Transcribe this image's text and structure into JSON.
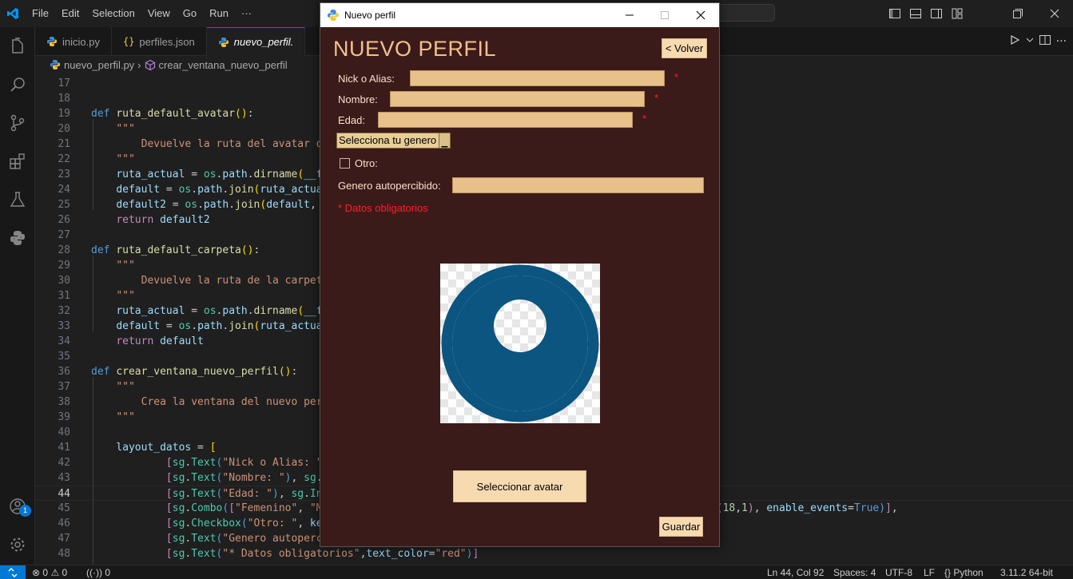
{
  "menu": [
    "File",
    "Edit",
    "Selection",
    "View",
    "Go",
    "Run",
    "···"
  ],
  "tabs": [
    {
      "label": "inicio.py",
      "icon": "python-icon"
    },
    {
      "label": "perfiles.json",
      "icon": "json-icon"
    },
    {
      "label": "nuevo_perfil.",
      "icon": "python-icon"
    }
  ],
  "breadcrumb": {
    "file": "nuevo_perfil.py",
    "symbol": "crear_ventana_nuevo_perfil"
  },
  "code_lines": [
    {
      "n": "17",
      "html": ""
    },
    {
      "n": "18",
      "html": ""
    },
    {
      "n": "19",
      "html": "<span class='kw'>def</span> <span class='fn'>ruta_default_avatar</span><span class='punc'>()</span>:"
    },
    {
      "n": "20",
      "html": "    <span class='str'>\"\"\"</span>"
    },
    {
      "n": "21",
      "html": "<span class='str'>        Devuelve la ruta del avatar d</span>"
    },
    {
      "n": "22",
      "html": "    <span class='str'>\"\"\"</span>"
    },
    {
      "n": "23",
      "html": "    <span class='var'>ruta_actual</span> = <span class='cls'>os</span>.<span class='var'>path</span>.<span class='fn'>dirname</span><span class='punc'>(</span><span class='var'>__f</span>"
    },
    {
      "n": "24",
      "html": "    <span class='var'>default</span> = <span class='cls'>os</span>.<span class='var'>path</span>.<span class='fn'>join</span><span class='punc'>(</span><span class='var'>ruta_actua</span>"
    },
    {
      "n": "25",
      "html": "    <span class='var'>default2</span> = <span class='cls'>os</span>.<span class='var'>path</span>.<span class='fn'>join</span><span class='punc'>(</span><span class='var'>default</span>,"
    },
    {
      "n": "26",
      "html": "    <span class='kw2'>return</span> <span class='var'>default2</span>"
    },
    {
      "n": "27",
      "html": ""
    },
    {
      "n": "28",
      "html": "<span class='kw'>def</span> <span class='fn'>ruta_default_carpeta</span><span class='punc'>()</span>:"
    },
    {
      "n": "29",
      "html": "    <span class='str'>\"\"\"</span>"
    },
    {
      "n": "30",
      "html": "<span class='str'>        Devuelve la ruta de la carpet</span>"
    },
    {
      "n": "31",
      "html": "    <span class='str'>\"\"\"</span>"
    },
    {
      "n": "32",
      "html": "    <span class='var'>ruta_actual</span> = <span class='cls'>os</span>.<span class='var'>path</span>.<span class='fn'>dirname</span><span class='punc'>(</span><span class='var'>__f</span>"
    },
    {
      "n": "33",
      "html": "    <span class='var'>default</span> = <span class='cls'>os</span>.<span class='var'>path</span>.<span class='fn'>join</span><span class='punc'>(</span><span class='var'>ruta_actua</span>"
    },
    {
      "n": "34",
      "html": "    <span class='kw2'>return</span> <span class='var'>default</span>"
    },
    {
      "n": "35",
      "html": ""
    },
    {
      "n": "36",
      "html": "<span class='kw'>def</span> <span class='fn'>crear_ventana_nuevo_perfil</span><span class='punc'>()</span>:"
    },
    {
      "n": "37",
      "html": "    <span class='str'>\"\"\"</span>"
    },
    {
      "n": "38",
      "html": "<span class='str'>        Crea la ventana del nuevo per</span>"
    },
    {
      "n": "39",
      "html": "    <span class='str'>\"\"\"</span>"
    },
    {
      "n": "40",
      "html": ""
    },
    {
      "n": "41",
      "html": "    <span class='var'>layout_datos</span> = <span class='punc'>[</span>"
    },
    {
      "n": "42",
      "html": "            <span class='kw2'>[</span><span class='cls'>sg</span>.<span class='cls'>Text</span><span class='kw'>(</span><span class='str'>\"Nick o Alias: \"</span>"
    },
    {
      "n": "43",
      "html": "            <span class='kw2'>[</span><span class='cls'>sg</span>.<span class='cls'>Text</span><span class='kw'>(</span><span class='str'>\"Nombre: \"</span><span class='kw'>)</span>, <span class='cls'>sg</span>."
    },
    {
      "n": "44",
      "html": "            <span class='kw2'>[</span><span class='cls'>sg</span>.<span class='cls'>Text</span><span class='kw'>(</span><span class='str'>\"Edad: \"</span><span class='kw'>)</span>, <span class='cls'>sg</span>.<span class='cls'>In</span>"
    },
    {
      "n": "45",
      "html": "            <span class='kw2'>[</span><span class='cls'>sg</span>.<span class='cls'>Combo</span><span class='kw'>(</span><span class='kw2'>[</span><span class='str'>\"Femenino\"</span>, <span class='str'>\"M</span>                                           <span class='var'>readonly</span>=<span class='bool'>True</span>, <span class='var'>size</span>=<span class='kw2'>(</span><span class='num'>18</span>,<span class='num'>1</span><span class='kw2'>)</span>, <span class='var'>enable_events</span>=<span class='bool'>True</span><span class='kw'>)</span><span class='kw2'>]</span>,"
    },
    {
      "n": "46",
      "html": "            <span class='kw2'>[</span><span class='cls'>sg</span>.<span class='cls'>Checkbox</span><span class='kw'>(</span><span class='str'>\"Otro: \"</span>, <span class='var'>ke</span>"
    },
    {
      "n": "47",
      "html": "            <span class='kw2'>[</span><span class='cls'>sg</span>.<span class='cls'>Text</span><span class='kw'>(</span><span class='str'>\"Genero autoperc</span>"
    },
    {
      "n": "48",
      "html": "            <span class='kw2'>[</span><span class='cls'>sg</span>.<span class='cls'>Text</span><span class='kw'>(</span><span class='str'>\"* Datos obligatorios\"</span>,<span class='var'>text_color</span>=<span class='str'>\"red\"</span><span class='kw'>)</span><span class='kw2'>]</span>"
    }
  ],
  "current_line": "44",
  "status": {
    "errors": "0",
    "warnings": "0",
    "ports": "0",
    "position": "Ln 44, Col 92",
    "spaces": "Spaces: 4",
    "encoding": "UTF-8",
    "eol": "LF",
    "language": "Python",
    "interpreter": "3.11.2 64-bit"
  },
  "accounts_badge": "1",
  "popup": {
    "title": "Nuevo perfil",
    "heading": "NUEVO PERFIL",
    "back_button": "< Volver",
    "nick_label": "Nick o Alias:",
    "nombre_label": "Nombre:",
    "edad_label": "Edad:",
    "star": "*",
    "combo_value": "Selecciona tu genero",
    "otro_label": "Otro:",
    "genero_label": "Genero autopercibido:",
    "required_note": "* Datos obligatorios",
    "select_avatar_button": "Seleccionar avatar",
    "save_button": "Guardar"
  },
  "colors": {
    "popup_bg": "#3b1a1a",
    "heading": "#f2c18d",
    "input_bg": "#e8c08a",
    "button_bg": "#f7dab0",
    "required": "#ff2020",
    "avatar": "#0b5580",
    "accent": "#0078d4"
  }
}
